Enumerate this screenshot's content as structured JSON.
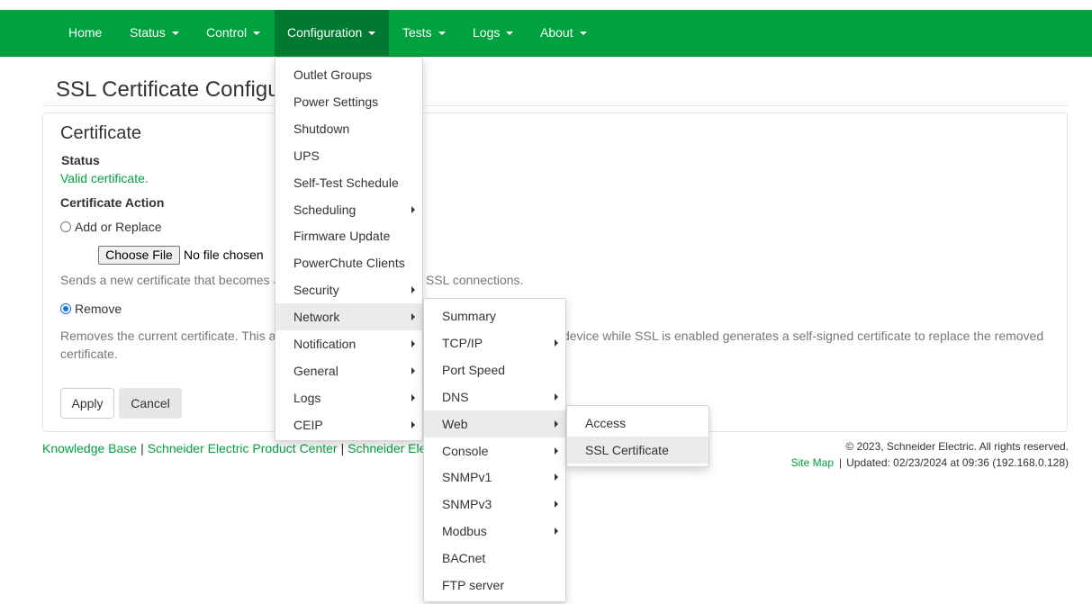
{
  "nav": {
    "items": [
      {
        "label": "Home",
        "caret": false
      },
      {
        "label": "Status",
        "caret": true
      },
      {
        "label": "Control",
        "caret": true
      },
      {
        "label": "Configuration",
        "caret": true
      },
      {
        "label": "Tests",
        "caret": true
      },
      {
        "label": "Logs",
        "caret": true
      },
      {
        "label": "About",
        "caret": true
      }
    ],
    "active_item": "Configuration",
    "color": "#00a13f"
  },
  "page": {
    "title": "SSL Certificate Configu",
    "panel_title": "Certificate",
    "status_label": "Status",
    "status_value": "Valid certificate.",
    "action_label": "Certificate Action",
    "option_add": "Add or Replace",
    "choose_file": "Choose File",
    "no_file": "No file chosen",
    "add_help": "Sends a new certificate that becomes a",
    "add_help_tail": "SSL connections.",
    "option_remove": "Remove",
    "selected_option": "Remove",
    "remove_help_1": "Removes the current certificate. This a",
    "remove_help_1_tail": "device while SSL is enabled generates a self-signed certificate to replace the removed",
    "remove_help_2": "certificate.",
    "apply": "Apply",
    "cancel": "Cancel"
  },
  "footer": {
    "links": [
      "Knowledge Base",
      "Schneider Electric Product Center",
      "Schneider Ele"
    ],
    "copyright": "© 2023, Schneider Electric. All rights reserved.",
    "site_map": "Site Map",
    "updated": "Updated: 02/23/2024 at 09:36 (192.168.0.128)"
  },
  "menus": {
    "configuration": [
      {
        "label": "Outlet Groups",
        "sub": false
      },
      {
        "label": "Power Settings",
        "sub": false
      },
      {
        "label": "Shutdown",
        "sub": false
      },
      {
        "label": "UPS",
        "sub": false
      },
      {
        "label": "Self-Test Schedule",
        "sub": false
      },
      {
        "label": "Scheduling",
        "sub": true
      },
      {
        "label": "Firmware Update",
        "sub": false
      },
      {
        "label": "PowerChute Clients",
        "sub": false
      },
      {
        "label": "Security",
        "sub": true
      },
      {
        "label": "Network",
        "sub": true,
        "highlight": true
      },
      {
        "label": "Notification",
        "sub": true
      },
      {
        "label": "General",
        "sub": true
      },
      {
        "label": "Logs",
        "sub": true
      },
      {
        "label": "CEIP",
        "sub": true
      }
    ],
    "network": [
      {
        "label": "Summary",
        "sub": false
      },
      {
        "label": "TCP/IP",
        "sub": true
      },
      {
        "label": "Port Speed",
        "sub": false
      },
      {
        "label": "DNS",
        "sub": true
      },
      {
        "label": "Web",
        "sub": true,
        "highlight": true
      },
      {
        "label": "Console",
        "sub": true
      },
      {
        "label": "SNMPv1",
        "sub": true
      },
      {
        "label": "SNMPv3",
        "sub": true
      },
      {
        "label": "Modbus",
        "sub": true
      },
      {
        "label": "BACnet",
        "sub": false
      },
      {
        "label": "FTP server",
        "sub": false
      }
    ],
    "web": [
      {
        "label": "Access",
        "sub": false
      },
      {
        "label": "SSL Certificate",
        "sub": false,
        "highlight": true
      }
    ]
  }
}
